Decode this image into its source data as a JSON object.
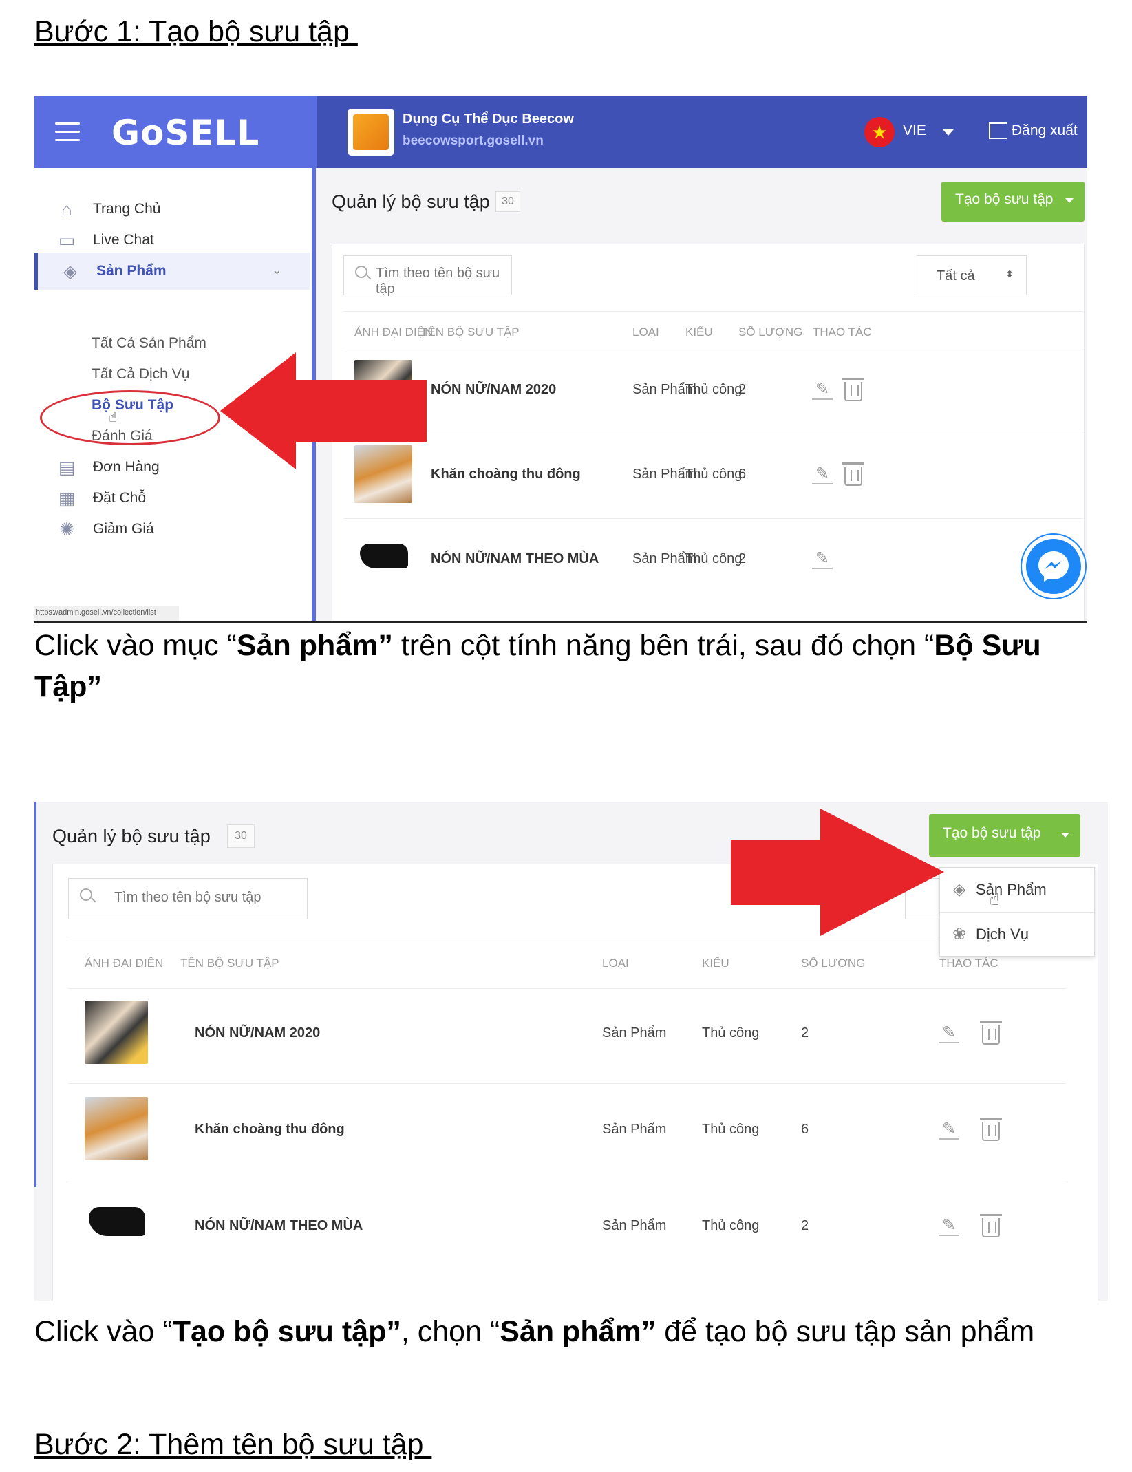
{
  "step1": {
    "heading": "Bước 1: Tạo bộ sưu tập "
  },
  "step2": {
    "heading": "Bước 2: Thêm tên bộ sưu tập "
  },
  "caption1": {
    "part1": "Click vào mục “",
    "bold1": "Sản phẩm”",
    "part2": " trên cột tính năng bên trái, sau đó chọn “",
    "bold2": "Bộ Sưu Tập”"
  },
  "caption2": {
    "part1": "Click vào “",
    "bold1": "Tạo bộ sưu tập”",
    "part2": ", chọn “",
    "bold2": "Sản phẩm”",
    "part3": " để tạo bộ sưu tập sản phẩm"
  },
  "header": {
    "logo": "GoSELL",
    "shop_name": "Dụng Cụ Thể Dục Beecow",
    "shop_url": "beecowsport.gosell.vn",
    "language": "VIE",
    "logout": "Đăng xuất"
  },
  "sidebar": {
    "items": [
      {
        "label": "Trang Chủ",
        "icon": "home-icon"
      },
      {
        "label": "Live Chat",
        "icon": "chat-icon"
      },
      {
        "label": "Sản Phẩm",
        "icon": "tag-icon"
      },
      {
        "label": "Đơn Hàng",
        "icon": "receipt-icon"
      },
      {
        "label": "Đặt Chỗ",
        "icon": "calendar-icon"
      },
      {
        "label": "Giảm Giá",
        "icon": "discount-icon"
      }
    ],
    "sub_items": [
      "Tất Cả Sản Phẩm",
      "Tất Cả Dịch Vụ",
      "Bộ Sưu Tập",
      "Đánh Giá"
    ],
    "status_url": "https://admin.gosell.vn/collection/list"
  },
  "page": {
    "title": "Quản lý bộ sưu tập",
    "count": "30",
    "create_button": "Tạo bộ sưu tập",
    "search_placeholder": "Tìm theo tên bộ sưu tập",
    "filter_value": "Tất cả"
  },
  "table": {
    "headers": [
      "ẢNH ĐẠI DIỆN",
      "TÊN BỘ SƯU TẬP",
      "LOẠI",
      "KIỂU",
      "SỐ LƯỢNG",
      "THAO TÁC"
    ],
    "rows": [
      {
        "name": "NÓN NỮ/NAM 2020",
        "type": "Sản Phẩm",
        "mode": "Thủ công",
        "qty": "2"
      },
      {
        "name": "Khăn choàng thu đông",
        "type": "Sản Phẩm",
        "mode": "Thủ công",
        "qty": "6"
      },
      {
        "name": "NÓN NỮ/NAM THEO MÙA",
        "type": "Sản Phẩm",
        "mode": "Thủ công",
        "qty": "2"
      }
    ]
  },
  "dropdown_menu": {
    "items": [
      {
        "label": "Sản Phẩm",
        "icon": "tag-icon"
      },
      {
        "label": "Dịch Vụ",
        "icon": "flower-icon"
      }
    ]
  },
  "colors": {
    "header_blue": "#3f51b5",
    "header_light": "#5b6ee1",
    "button_green": "#7ac143",
    "arrow_red": "#e8242b",
    "messenger_blue": "#1e88f7"
  }
}
